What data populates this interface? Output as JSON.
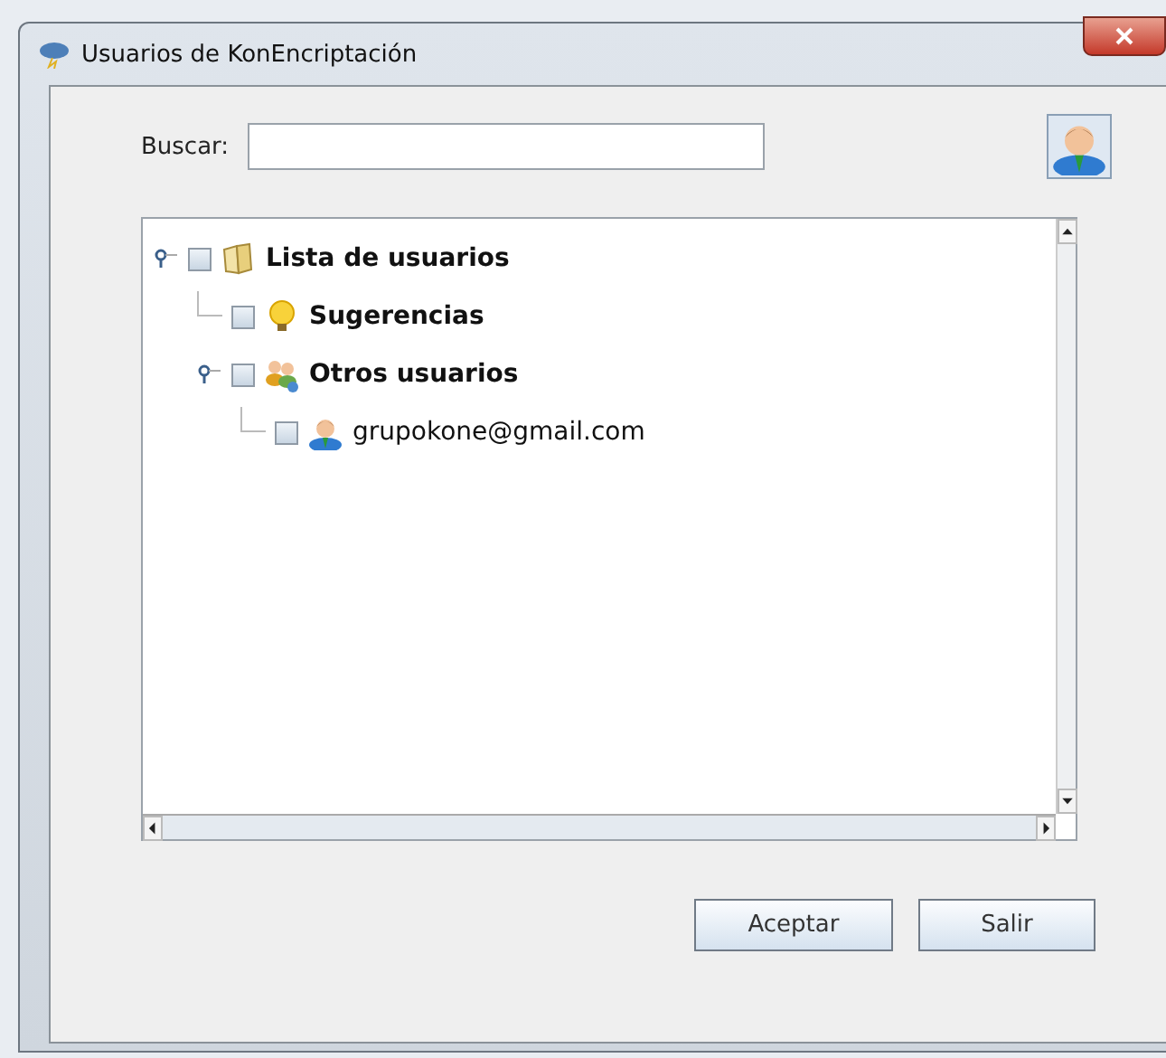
{
  "window": {
    "title": "Usuarios de KonEncriptación"
  },
  "search": {
    "label": "Buscar:"
  },
  "tree": [
    {
      "label": "Lista de usuarios",
      "kind": "book",
      "checked": false,
      "expanded": true,
      "children": [
        {
          "label": "Sugerencias",
          "kind": "bulb",
          "checked": false,
          "expanded": false
        },
        {
          "label": "Otros usuarios",
          "kind": "group",
          "checked": false,
          "expanded": true,
          "children": [
            {
              "label": "grupokone@gmail.com",
              "kind": "user",
              "checked": false,
              "expanded": false
            }
          ]
        }
      ]
    }
  ],
  "buttons": [
    "Aceptar",
    "Salir"
  ]
}
